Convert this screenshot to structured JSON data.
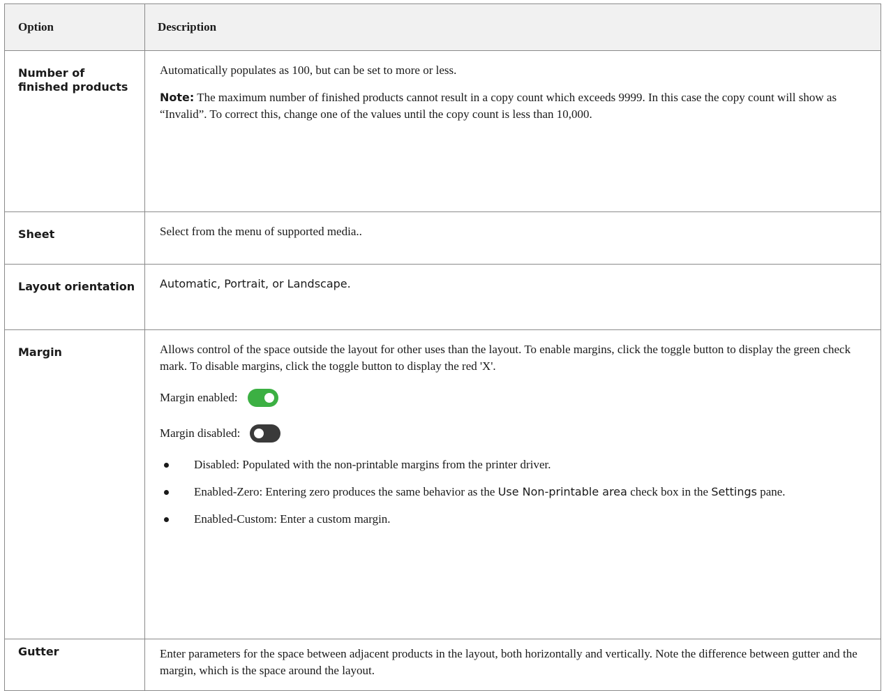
{
  "table": {
    "headers": {
      "option": "Option",
      "description": "Description"
    },
    "rows": {
      "number_of_finished_products": {
        "option": "Number of finished products",
        "description": "Automatically populates as 100, but can be set to more or less.",
        "note_label": "Note:",
        "note_text": " The maximum number of finished products cannot result in a copy count which exceeds 9999. In this case the copy count will show as “Invalid”. To correct this, change one of the values until the copy count is less than 10,000."
      },
      "sheet": {
        "option": "Sheet",
        "description": "Select from the menu of supported media.."
      },
      "layout_orientation": {
        "option": "Layout orientation",
        "description": "Automatic, Portrait, or Landscape."
      },
      "margin": {
        "option": "Margin",
        "description": "Allows control of the space outside the layout for other uses than the layout. To enable margins, click the toggle button to display the green check mark. To disable margins, click the toggle button to display the red 'X'.",
        "enabled_label": "Margin enabled:",
        "disabled_label": "Margin disabled:",
        "bullets": {
          "disabled": "Disabled: Populated with the non-printable margins from the printer driver.",
          "enabled_zero_before": "Enabled-Zero: Entering zero produces the same behavior as the ",
          "enabled_zero_ui1": "Use Non-printable area",
          "enabled_zero_mid": " check box in the ",
          "enabled_zero_ui2": "Settings",
          "enabled_zero_after": " pane.",
          "enabled_custom": "Enabled-Custom: Enter a custom margin."
        }
      },
      "gutter": {
        "option": "Gutter",
        "description": "Enter parameters for the space between adjacent products in the layout, both horizontally and vertically. Note the difference between gutter and the margin, which is the space around the layout."
      }
    }
  },
  "colors": {
    "toggle_enabled": "#3cb043",
    "toggle_disabled": "#3a3a3a",
    "header_background": "#f1f1f1",
    "border": "#8a8a8a"
  },
  "icons": {
    "toggle_enabled": "toggle-on-icon",
    "toggle_disabled": "toggle-off-icon",
    "bullet": "bullet-dot-icon"
  }
}
